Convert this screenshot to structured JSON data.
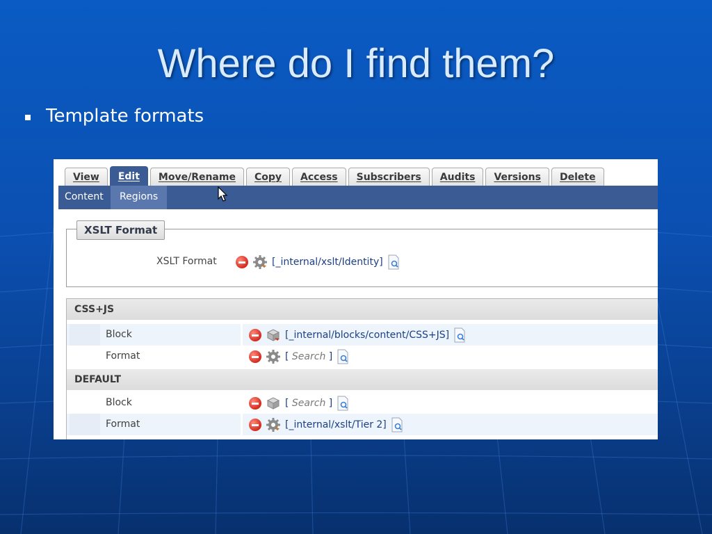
{
  "slide": {
    "title": "Where do I find them?",
    "bullet": "Template formats"
  },
  "cms": {
    "tabs": [
      "View",
      "Edit",
      "Move/Rename",
      "Copy",
      "Access",
      "Subscribers",
      "Audits",
      "Versions",
      "Delete"
    ],
    "active_tab": "Edit",
    "subtabs": {
      "content": "Content",
      "regions": "Regions"
    },
    "xslt_section": {
      "legend": "XSLT Format",
      "label": "XSLT Format",
      "value": "[_internal/xslt/Identity]"
    },
    "regions": [
      {
        "name": "CSS+JS",
        "rows": [
          {
            "label": "Block",
            "value": "[_internal/blocks/content/CSS+JS]",
            "icon": "block-icon"
          },
          {
            "label": "Format",
            "open": "[",
            "search": "Search",
            "close": "]",
            "icon": "gear-icon"
          }
        ]
      },
      {
        "name": "DEFAULT",
        "rows": [
          {
            "label": "Block",
            "open": "[",
            "search": "Search",
            "close": "]",
            "icon": "block-icon"
          },
          {
            "label": "Format",
            "value": "[_internal/xslt/Tier 2]",
            "icon": "gear-icon"
          }
        ]
      }
    ]
  },
  "colors": {
    "nav": "#3b5b95",
    "remove": "#d42a1e",
    "link": "#1b3f86"
  }
}
